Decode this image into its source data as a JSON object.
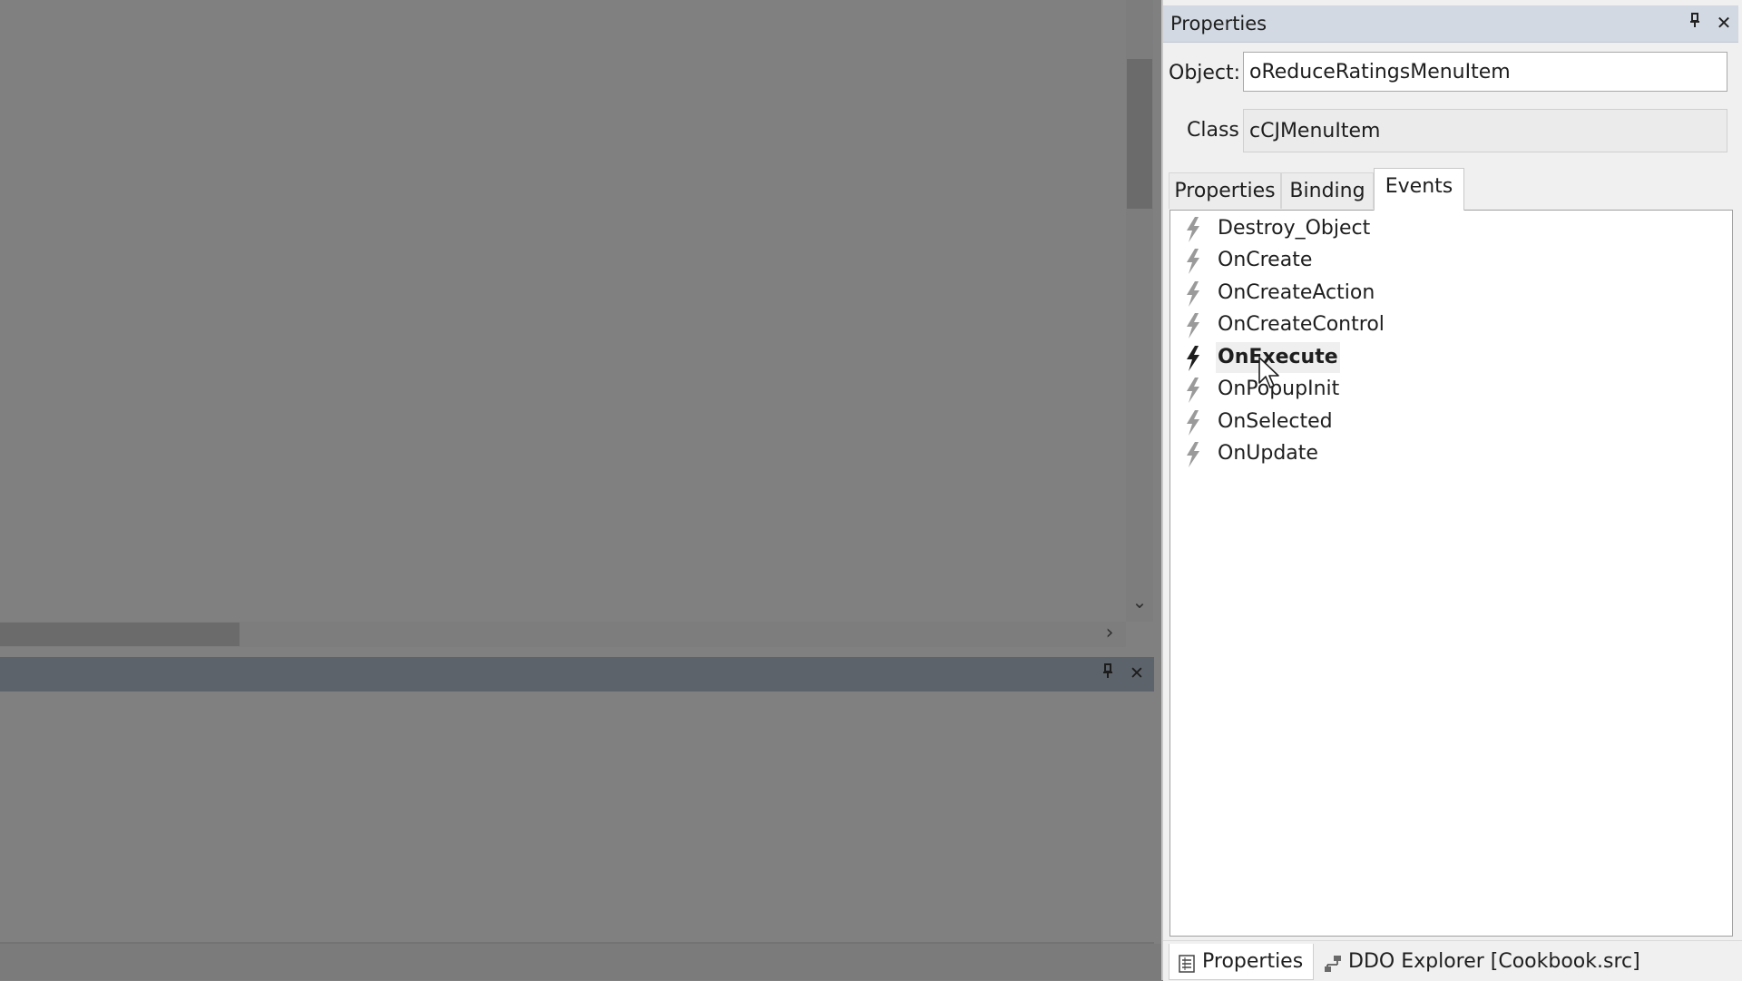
{
  "panel": {
    "title": "Properties",
    "pin_icon": "pin-icon",
    "close_icon": "close-icon",
    "object_label": "Object:",
    "object_value": "oReduceRatingsMenuItem",
    "class_label": "Class",
    "class_value": "cCJMenuItem",
    "tabs": [
      {
        "label": "Properties",
        "active": false
      },
      {
        "label": "Binding",
        "active": false
      },
      {
        "label": "Events",
        "active": true
      }
    ],
    "events": [
      {
        "name": "Destroy_Object",
        "implemented": false
      },
      {
        "name": "OnCreate",
        "implemented": false
      },
      {
        "name": "OnCreateAction",
        "implemented": false
      },
      {
        "name": "OnCreateControl",
        "implemented": false
      },
      {
        "name": "OnExecute",
        "implemented": true
      },
      {
        "name": "OnPopupInit",
        "implemented": false
      },
      {
        "name": "OnSelected",
        "implemented": false
      },
      {
        "name": "OnUpdate",
        "implemented": false
      }
    ],
    "bottom_tabs": [
      {
        "label": "Properties",
        "icon": "properties-grid-icon",
        "active": true
      },
      {
        "label": "DDO Explorer [Cookbook.src]",
        "icon": "ddo-tree-icon",
        "active": false
      }
    ]
  },
  "output_pane": {
    "pin_icon": "pin-icon",
    "close_icon": "close-icon"
  },
  "colors": {
    "panel_title_bg": "#d2d9e2",
    "output_title_bg": "#5d636b",
    "disabled_background": "#808080",
    "event_icon_inactive": "#9a9a9a",
    "event_icon_active": "#1e1e1e"
  }
}
